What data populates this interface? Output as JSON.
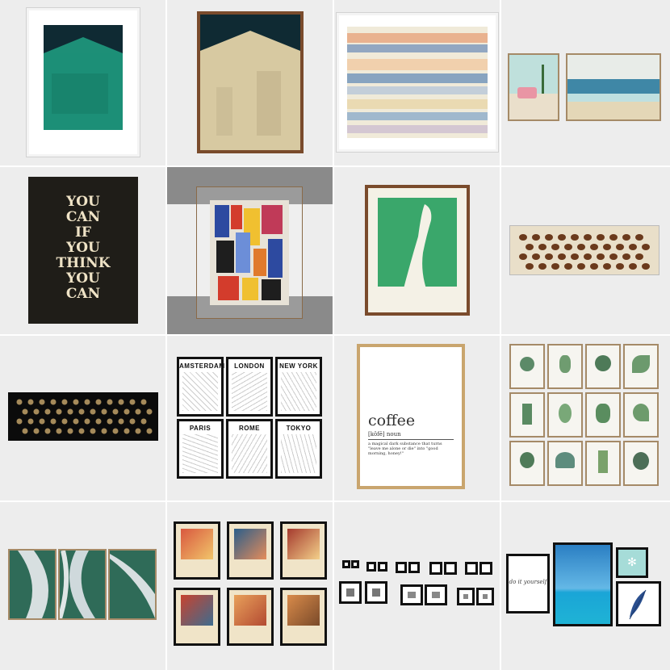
{
  "posters": {
    "you_can": [
      "YOU",
      "CAN",
      "IF",
      "YOU",
      "THINK",
      "YOU",
      "CAN"
    ]
  },
  "maps": [
    "AMSTERDAM",
    "LONDON",
    "NEW YORK",
    "PARIS",
    "ROME",
    "TOKYO"
  ],
  "coffee": {
    "word": "coffee",
    "pronunciation": "[kôfē] noun",
    "definition": "a magical dark substance that turns \"leave me alone or die\" into \"good morning, honey!\""
  },
  "script_print": "do it yourself",
  "colors": {
    "cell_bg": "#ededed",
    "teal": "#1d8f77",
    "navy": "#0f2a33",
    "sand": "#d7c9a1",
    "brown_frame": "#7a4b2c",
    "gold_frame": "#c9a56e",
    "black_poster": "#1f1d18"
  }
}
